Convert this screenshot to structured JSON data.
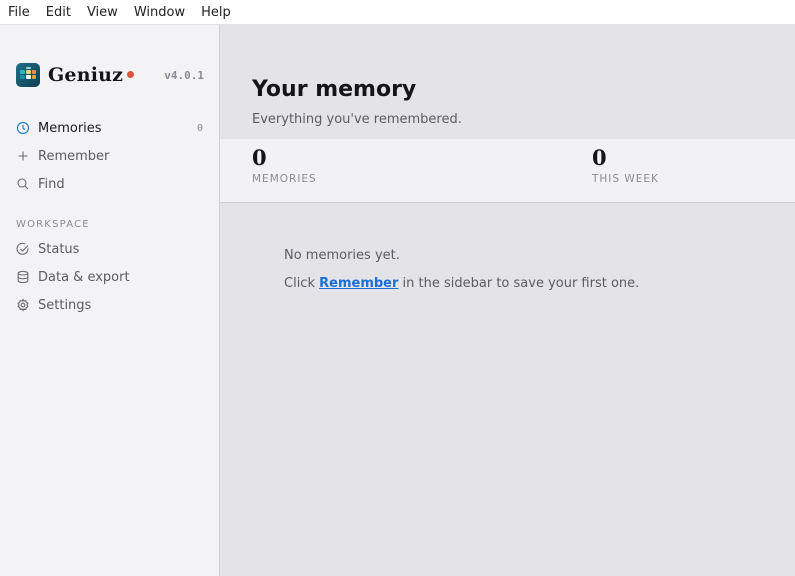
{
  "menubar": {
    "items": [
      "File",
      "Edit",
      "View",
      "Window",
      "Help"
    ]
  },
  "sidebar": {
    "brand": {
      "name": "Geniuz",
      "version": "v4.0.1",
      "dot_color": "#d9583b"
    },
    "nav": [
      {
        "label": "Memories",
        "icon": "clock-icon",
        "count": "0",
        "active": true
      },
      {
        "label": "Remember",
        "icon": "plus-icon"
      },
      {
        "label": "Find",
        "icon": "search-icon"
      }
    ],
    "section_label": "WORKSPACE",
    "workspace": [
      {
        "label": "Status",
        "icon": "check-circle-icon"
      },
      {
        "label": "Data & export",
        "icon": "database-icon"
      },
      {
        "label": "Settings",
        "icon": "gear-icon"
      }
    ]
  },
  "main": {
    "title": "Your memory",
    "subtitle": "Everything you've remembered.",
    "stats": [
      {
        "value": "0",
        "label": "MEMORIES"
      },
      {
        "value": "0",
        "label": "THIS WEEK"
      }
    ],
    "empty": {
      "line1": "No memories yet.",
      "line2_prefix": "Click",
      "line2_link": "Remember",
      "line2_suffix": "in the sidebar to save your first one."
    }
  },
  "colors": {
    "accent": "#1a6fd4",
    "active_icon": "#2a7fd0"
  }
}
